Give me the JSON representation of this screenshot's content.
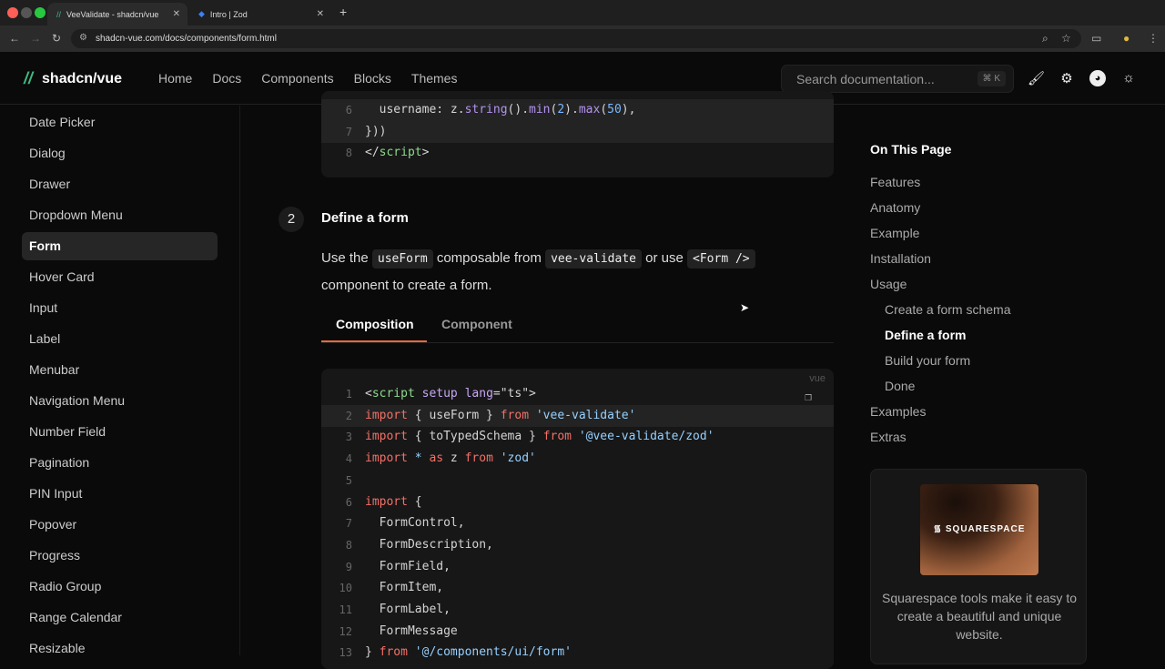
{
  "browser": {
    "tabs": [
      {
        "title": "VeeValidate - shadcn/vue",
        "active": true
      },
      {
        "title": "Intro | Zod",
        "active": false
      }
    ],
    "url": "shadcn-vue.com/docs/components/form.html"
  },
  "header": {
    "brand": "shadcn/vue",
    "nav": [
      "Home",
      "Docs",
      "Components",
      "Blocks",
      "Themes"
    ],
    "search_placeholder": "Search documentation...",
    "search_shortcut": "⌘ K"
  },
  "sidebar": {
    "items": [
      "Date Picker",
      "Dialog",
      "Drawer",
      "Dropdown Menu",
      "Form",
      "Hover Card",
      "Input",
      "Label",
      "Menubar",
      "Navigation Menu",
      "Number Field",
      "Pagination",
      "PIN Input",
      "Popover",
      "Progress",
      "Radio Group",
      "Range Calendar",
      "Resizable"
    ],
    "active": "Form"
  },
  "code_top": {
    "lines": [
      {
        "n": "6",
        "hl": true,
        "tokens": [
          [
            "  username: z.",
            ""
          ],
          [
            "string",
            "f"
          ],
          [
            "().",
            ""
          ],
          [
            "min",
            "f"
          ],
          [
            "(",
            ""
          ],
          [
            "2",
            "n"
          ],
          [
            ").",
            ""
          ],
          [
            "max",
            "f"
          ],
          [
            "(",
            ""
          ],
          [
            "50",
            "n"
          ],
          [
            "),",
            ""
          ]
        ]
      },
      {
        "n": "7",
        "hl": true,
        "tokens": [
          [
            "}))",
            ""
          ]
        ]
      },
      {
        "n": "8",
        "hl": false,
        "tokens": [
          [
            "</",
            ""
          ],
          [
            "script",
            "t"
          ],
          [
            ">",
            ""
          ]
        ]
      }
    ]
  },
  "step": {
    "number": "2",
    "title": "Define a form",
    "text": [
      "Use the ",
      "useForm",
      " composable from ",
      "vee-validate",
      " or use ",
      "<Form />",
      " component to create a form."
    ]
  },
  "code_tabs": [
    "Composition",
    "Component"
  ],
  "code_main": {
    "lang": "vue",
    "lines": [
      {
        "n": "1",
        "tokens": [
          [
            "<",
            ""
          ],
          [
            "script",
            "t"
          ],
          [
            " ",
            ""
          ],
          [
            "setup",
            "a"
          ],
          [
            " ",
            ""
          ],
          [
            "lang",
            "a"
          ],
          [
            "=\"ts\">",
            ""
          ]
        ]
      },
      {
        "n": "2",
        "hl": true,
        "tokens": [
          [
            "import",
            "k"
          ],
          [
            " { useForm } ",
            ""
          ],
          [
            "from",
            "k"
          ],
          [
            " 'vee-validate'",
            "s"
          ]
        ]
      },
      {
        "n": "3",
        "tokens": [
          [
            "import",
            "k"
          ],
          [
            " { toTypedSchema } ",
            ""
          ],
          [
            "from",
            "k"
          ],
          [
            " '@vee-validate/zod'",
            "s"
          ]
        ]
      },
      {
        "n": "4",
        "tokens": [
          [
            "import",
            "k"
          ],
          [
            " * ",
            "s"
          ],
          [
            "as",
            "k"
          ],
          [
            " z ",
            ""
          ],
          [
            "from",
            "k"
          ],
          [
            " 'zod'",
            "s"
          ]
        ]
      },
      {
        "n": "5",
        "tokens": []
      },
      {
        "n": "6",
        "tokens": [
          [
            "import",
            "k"
          ],
          [
            " {",
            ""
          ]
        ]
      },
      {
        "n": "7",
        "tokens": [
          [
            "  FormControl,",
            ""
          ]
        ]
      },
      {
        "n": "8",
        "tokens": [
          [
            "  FormDescription,",
            ""
          ]
        ]
      },
      {
        "n": "9",
        "tokens": [
          [
            "  FormField,",
            ""
          ]
        ]
      },
      {
        "n": "10",
        "tokens": [
          [
            "  FormItem,",
            ""
          ]
        ]
      },
      {
        "n": "11",
        "tokens": [
          [
            "  FormLabel,",
            ""
          ]
        ]
      },
      {
        "n": "12",
        "tokens": [
          [
            "  FormMessage",
            ""
          ]
        ]
      },
      {
        "n": "13",
        "tokens": [
          [
            "} ",
            ""
          ],
          [
            "from",
            "k"
          ],
          [
            " '@/components/ui/form'",
            "s"
          ]
        ]
      }
    ]
  },
  "toc": {
    "title": "On This Page",
    "items": [
      {
        "label": "Features",
        "level": 1
      },
      {
        "label": "Anatomy",
        "level": 1
      },
      {
        "label": "Example",
        "level": 1
      },
      {
        "label": "Installation",
        "level": 1
      },
      {
        "label": "Usage",
        "level": 1
      },
      {
        "label": "Create a form schema",
        "level": 2
      },
      {
        "label": "Define a form",
        "level": 2,
        "active": true
      },
      {
        "label": "Build your form",
        "level": 2
      },
      {
        "label": "Done",
        "level": 2
      },
      {
        "label": "Examples",
        "level": 1
      },
      {
        "label": "Extras",
        "level": 1
      }
    ]
  },
  "ad": {
    "logo": "SQUARESPACE",
    "text": "Squarespace tools make it easy to create a beautiful and unique website."
  },
  "colors": {
    "accent": "#e86a3b",
    "brand": "#41b883"
  }
}
